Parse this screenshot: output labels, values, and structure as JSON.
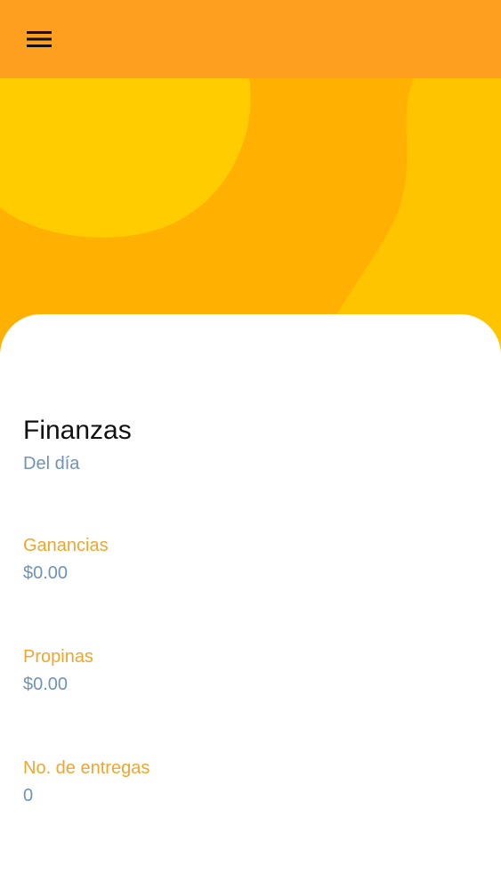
{
  "header": {
    "menu_icon": "hamburger-menu-icon",
    "background_color": "#ff9f1f"
  },
  "hero": {
    "colors": {
      "base": "#ffb000",
      "blob_left": "#ffcc00",
      "blob_right": "#ffc400"
    }
  },
  "finance": {
    "title": "Finanzas",
    "subtitle": "Del día",
    "stats": [
      {
        "label": "Ganancias",
        "value": "$0.00"
      },
      {
        "label": "Propinas",
        "value": "$0.00"
      },
      {
        "label": "No. de entregas",
        "value": "0"
      }
    ]
  },
  "colors": {
    "title": "#111111",
    "subtitle": "#6f93b5",
    "label": "#f0a52d",
    "value": "#6f93b5"
  }
}
